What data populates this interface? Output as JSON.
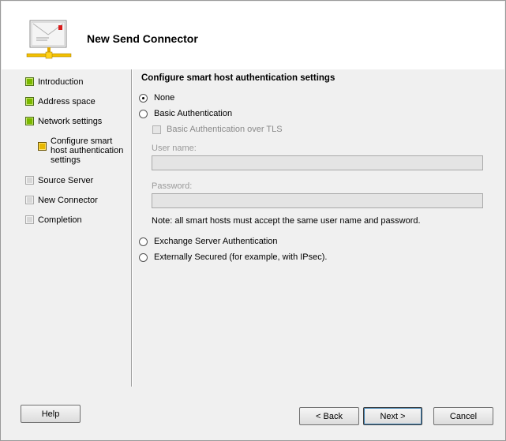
{
  "wizard": {
    "title": "New Send Connector"
  },
  "steps": [
    {
      "label": "Introduction",
      "state": "done"
    },
    {
      "label": "Address space",
      "state": "done"
    },
    {
      "label": "Network settings",
      "state": "done"
    },
    {
      "label": "Configure smart host authentication settings",
      "state": "current"
    },
    {
      "label": "Source Server",
      "state": "pending"
    },
    {
      "label": "New Connector",
      "state": "pending"
    },
    {
      "label": "Completion",
      "state": "pending"
    }
  ],
  "content": {
    "section_title": "Configure smart host authentication settings",
    "options": {
      "none": {
        "label": "None",
        "selected": true
      },
      "basic": {
        "label": "Basic Authentication",
        "selected": false
      },
      "exchange": {
        "label": "Exchange Server Authentication",
        "selected": false
      },
      "external": {
        "label": "Externally Secured (for example, with IPsec).",
        "selected": false
      }
    },
    "basic_over_tls": {
      "label": "Basic Authentication over TLS",
      "checked": false,
      "enabled": false
    },
    "username": {
      "label": "User name:",
      "value": ""
    },
    "password": {
      "label": "Password:",
      "value": ""
    },
    "note": "Note: all smart hosts must accept the same user name and password."
  },
  "buttons": {
    "help": "Help",
    "back": "< Back",
    "next": "Next >",
    "cancel": "Cancel"
  },
  "colors": {
    "done": "#7ab800",
    "current": "#e8b800",
    "pending": "#d8d8d8",
    "background": "#f0f0f0"
  }
}
